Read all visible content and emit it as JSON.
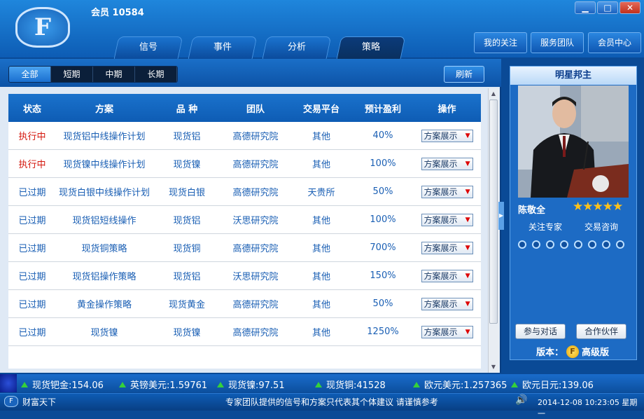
{
  "app": {
    "member_label": "会员 10584",
    "logo_letter": "F"
  },
  "window_controls": {
    "minimize": "▁",
    "maximize": "□",
    "close": "✕"
  },
  "nav_tabs": [
    {
      "label": "信号"
    },
    {
      "label": "事件"
    },
    {
      "label": "分析"
    },
    {
      "label": "策略"
    }
  ],
  "top_buttons": [
    {
      "label": "我的关注"
    },
    {
      "label": "服务团队"
    },
    {
      "label": "会员中心"
    }
  ],
  "filters": [
    {
      "label": "全部"
    },
    {
      "label": "短期"
    },
    {
      "label": "中期"
    },
    {
      "label": "长期"
    }
  ],
  "refresh_label": "刷新",
  "table": {
    "headers": [
      "状态",
      "方案",
      "品 种",
      "团队",
      "交易平台",
      "预计盈利",
      "操作"
    ],
    "rows": [
      {
        "status": "执行中",
        "plan": "现货铝中线操作计划",
        "variety": "现货铝",
        "team": "高德研究院",
        "platform": "其他",
        "profit": "40%",
        "action": "方案展示"
      },
      {
        "status": "执行中",
        "plan": "现货镍中线操作计划",
        "variety": "现货镍",
        "team": "高德研究院",
        "platform": "其他",
        "profit": "100%",
        "action": "方案展示"
      },
      {
        "status": "已过期",
        "plan": "现货白银中线操作计划",
        "variety": "现货白银",
        "team": "高德研究院",
        "platform": "天贵所",
        "profit": "50%",
        "action": "方案展示"
      },
      {
        "status": "已过期",
        "plan": "现货铝短线操作",
        "variety": "现货铝",
        "team": "沃思研究院",
        "platform": "其他",
        "profit": "100%",
        "action": "方案展示"
      },
      {
        "status": "已过期",
        "plan": "现货铜策略",
        "variety": "现货铜",
        "team": "高德研究院",
        "platform": "其他",
        "profit": "700%",
        "action": "方案展示"
      },
      {
        "status": "已过期",
        "plan": "现货铝操作策略",
        "variety": "现货铝",
        "team": "沃思研究院",
        "platform": "其他",
        "profit": "150%",
        "action": "方案展示"
      },
      {
        "status": "已过期",
        "plan": "黄金操作策略",
        "variety": "现货黄金",
        "team": "高德研究院",
        "platform": "其他",
        "profit": "50%",
        "action": "方案展示"
      },
      {
        "status": "已过期",
        "plan": "现货镍",
        "variety": "现货镍",
        "team": "高德研究院",
        "platform": "其他",
        "profit": "1250%",
        "action": "方案展示"
      }
    ]
  },
  "star_panel": {
    "title": "明星邦主",
    "name": "陈敬全",
    "rating": 5,
    "stars": "★★★★★",
    "link_follow": "关注专家",
    "link_consult": "交易咨询",
    "dot_count": 8,
    "btn_chat": "参与对话",
    "btn_partner": "合作伙伴",
    "version_label": "版本：",
    "version_value": "高级版"
  },
  "ticker": [
    {
      "text": "现货钯金:154.06"
    },
    {
      "text": "英镑美元:1.59761"
    },
    {
      "text": "现货镍:97.51"
    },
    {
      "text": "现货铜:41528"
    },
    {
      "text": "欧元美元:1.257365"
    },
    {
      "text": "欧元日元:139.06"
    }
  ],
  "statusbar": {
    "brand": "财富天下",
    "notice": "专家团队提供的信号和方案只代表其个体建议 请谨慎参考",
    "datetime": "2014-12-08 10:23:05 星期一"
  },
  "colors": {
    "running": "#d4160c",
    "expired": "#1a5fb4",
    "ticker_up": "#35d13a",
    "stars": "#ffc21a"
  }
}
